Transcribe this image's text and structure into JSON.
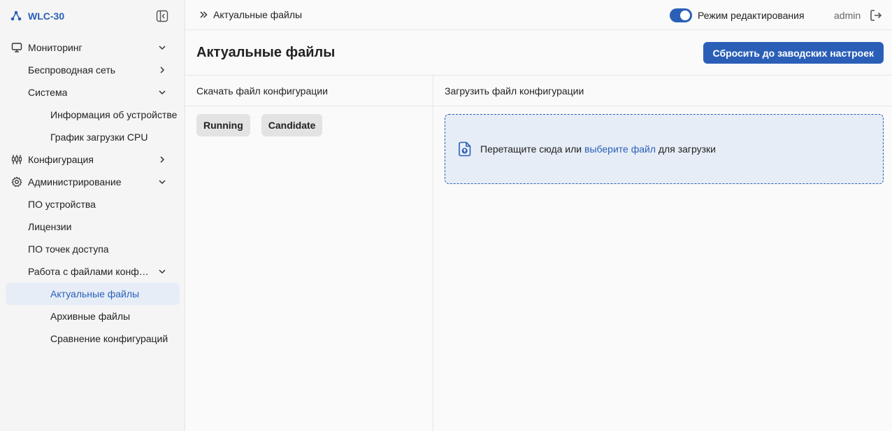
{
  "app": {
    "name": "WLC-30"
  },
  "colors": {
    "accent": "#2b5fb7",
    "active_bg": "#e6edf7"
  },
  "sidebar": {
    "items": [
      {
        "label": "Мониторинг",
        "icon": "monitor-icon",
        "chevron": "down"
      },
      {
        "label": "Беспроводная сеть",
        "chevron": "right"
      },
      {
        "label": "Система",
        "chevron": "down"
      },
      {
        "label": "Информация об устройстве"
      },
      {
        "label": "График загрузки CPU"
      },
      {
        "label": "Конфигурация",
        "icon": "sliders-icon",
        "chevron": "right"
      },
      {
        "label": "Администрирование",
        "icon": "gear-icon",
        "chevron": "down"
      },
      {
        "label": "ПО устройства"
      },
      {
        "label": "Лицензии"
      },
      {
        "label": "ПО точек доступа"
      },
      {
        "label": "Работа с файлами конфигурации",
        "chevron": "down"
      },
      {
        "label": "Актуальные файлы",
        "active": true
      },
      {
        "label": "Архивные файлы"
      },
      {
        "label": "Сравнение конфигураций"
      }
    ]
  },
  "topbar": {
    "breadcrumb": "Актуальные файлы",
    "edit_mode_label": "Режим редактирования",
    "edit_mode_on": true,
    "user": "admin"
  },
  "page": {
    "title": "Актуальные файлы",
    "reset_button": "Сбросить до заводских настроек"
  },
  "download": {
    "title": "Скачать файл конфигурации",
    "files": [
      "Running",
      "Candidate"
    ]
  },
  "upload": {
    "title": "Загрузить файл конфигурации",
    "text_before": "Перетащите сюда или ",
    "link": "выберите файл",
    "text_after": " для загрузки"
  }
}
